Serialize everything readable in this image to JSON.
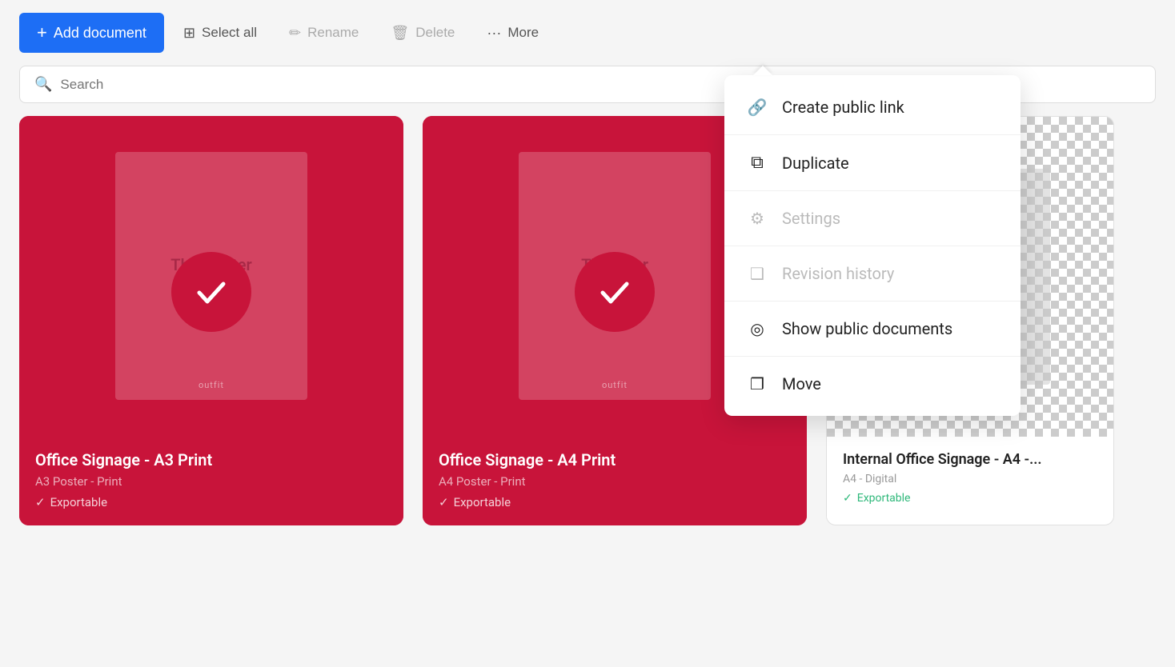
{
  "toolbar": {
    "add_label": "Add document",
    "select_all_label": "Select all",
    "rename_label": "Rename",
    "delete_label": "Delete",
    "more_label": "More"
  },
  "search": {
    "placeholder": "Search"
  },
  "dropdown": {
    "items": [
      {
        "id": "create-public-link",
        "label": "Create public link",
        "icon": "🔗",
        "disabled": false
      },
      {
        "id": "duplicate",
        "label": "Duplicate",
        "icon": "⧉",
        "disabled": false
      },
      {
        "id": "settings",
        "label": "Settings",
        "icon": "⚙",
        "disabled": true
      },
      {
        "id": "revision-history",
        "label": "Revision history",
        "icon": "❑",
        "disabled": true
      },
      {
        "id": "show-public-documents",
        "label": "Show public documents",
        "icon": "◎",
        "disabled": false
      },
      {
        "id": "move",
        "label": "Move",
        "icon": "❐",
        "disabled": false
      }
    ]
  },
  "cards": [
    {
      "id": "card-1",
      "type": "red",
      "title": "Office Signage - A3 Print",
      "subtitle": "A3 Poster - Print",
      "exportable": "Exportable",
      "poster_text": "This poster w e",
      "selected": true
    },
    {
      "id": "card-2",
      "type": "red",
      "title": "Office Signage - A4 Print",
      "subtitle": "A4 Poster - Print",
      "exportable": "Exportable",
      "poster_text": "This ster e",
      "selected": true
    },
    {
      "id": "card-3",
      "type": "white",
      "title": "Internal Office Signage - A4 -...",
      "subtitle": "A4 - Digital",
      "exportable": "Exportable",
      "selected": false
    }
  ]
}
